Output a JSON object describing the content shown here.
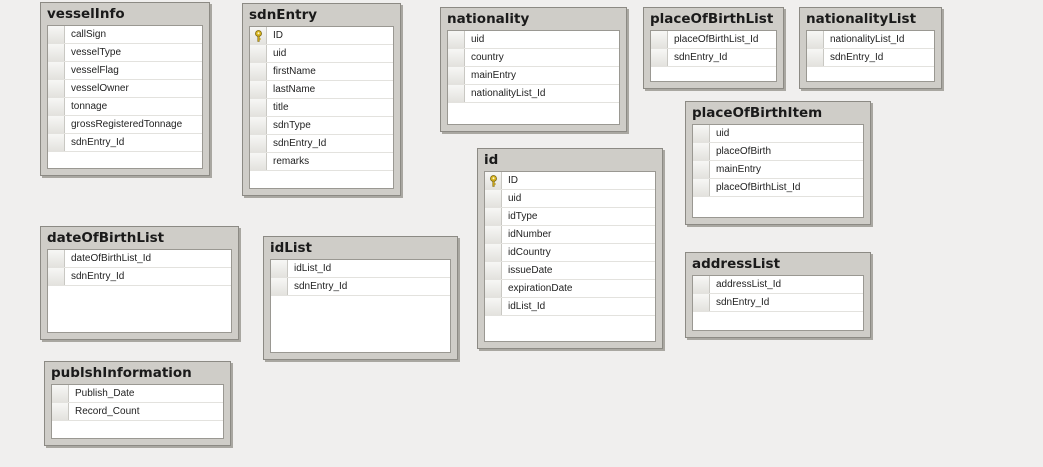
{
  "tables": [
    {
      "id": "vesselInfo",
      "name": "vesselInfo",
      "columns": [
        {
          "name": "callSign",
          "pk": false
        },
        {
          "name": "vesselType",
          "pk": false
        },
        {
          "name": "vesselFlag",
          "pk": false
        },
        {
          "name": "vesselOwner",
          "pk": false
        },
        {
          "name": "tonnage",
          "pk": false
        },
        {
          "name": "grossRegisteredTonnage",
          "pk": false
        },
        {
          "name": "sdnEntry_Id",
          "pk": false
        }
      ]
    },
    {
      "id": "sdnEntry",
      "name": "sdnEntry",
      "columns": [
        {
          "name": "ID",
          "pk": true
        },
        {
          "name": "uid",
          "pk": false
        },
        {
          "name": "firstName",
          "pk": false
        },
        {
          "name": "lastName",
          "pk": false
        },
        {
          "name": "title",
          "pk": false
        },
        {
          "name": "sdnType",
          "pk": false
        },
        {
          "name": "sdnEntry_Id",
          "pk": false
        },
        {
          "name": "remarks",
          "pk": false
        }
      ]
    },
    {
      "id": "nationality",
      "name": "nationality",
      "columns": [
        {
          "name": "uid",
          "pk": false
        },
        {
          "name": "country",
          "pk": false
        },
        {
          "name": "mainEntry",
          "pk": false
        },
        {
          "name": "nationalityList_Id",
          "pk": false
        }
      ]
    },
    {
      "id": "placeOfBirthList",
      "name": "placeOfBirthList",
      "columns": [
        {
          "name": "placeOfBirthList_Id",
          "pk": false
        },
        {
          "name": "sdnEntry_Id",
          "pk": false
        }
      ]
    },
    {
      "id": "nationalityList",
      "name": "nationalityList",
      "columns": [
        {
          "name": "nationalityList_Id",
          "pk": false
        },
        {
          "name": "sdnEntry_Id",
          "pk": false
        }
      ]
    },
    {
      "id": "placeOfBirthItem",
      "name": "placeOfBirthItem",
      "columns": [
        {
          "name": "uid",
          "pk": false
        },
        {
          "name": "placeOfBirth",
          "pk": false
        },
        {
          "name": "mainEntry",
          "pk": false
        },
        {
          "name": "placeOfBirthList_Id",
          "pk": false
        }
      ]
    },
    {
      "id": "id",
      "name": "id",
      "columns": [
        {
          "name": "ID",
          "pk": true
        },
        {
          "name": "uid",
          "pk": false
        },
        {
          "name": "idType",
          "pk": false
        },
        {
          "name": "idNumber",
          "pk": false
        },
        {
          "name": "idCountry",
          "pk": false
        },
        {
          "name": "issueDate",
          "pk": false
        },
        {
          "name": "expirationDate",
          "pk": false
        },
        {
          "name": "idList_Id",
          "pk": false
        }
      ]
    },
    {
      "id": "dateOfBirthList",
      "name": "dateOfBirthList",
      "columns": [
        {
          "name": "dateOfBirthList_Id",
          "pk": false
        },
        {
          "name": "sdnEntry_Id",
          "pk": false
        }
      ]
    },
    {
      "id": "idList",
      "name": "idList",
      "columns": [
        {
          "name": "idList_Id",
          "pk": false
        },
        {
          "name": "sdnEntry_Id",
          "pk": false
        }
      ]
    },
    {
      "id": "addressList",
      "name": "addressList",
      "columns": [
        {
          "name": "addressList_Id",
          "pk": false
        },
        {
          "name": "sdnEntry_Id",
          "pk": false
        }
      ]
    },
    {
      "id": "publshInformation",
      "name": "publshInformation",
      "columns": [
        {
          "name": "Publish_Date",
          "pk": false
        },
        {
          "name": "Record_Count",
          "pk": false
        }
      ]
    }
  ]
}
